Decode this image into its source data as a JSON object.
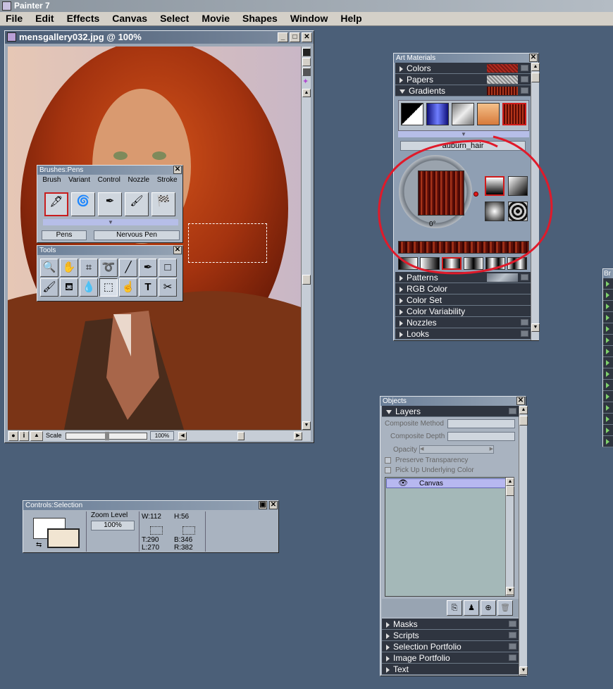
{
  "app": {
    "title": "Painter 7"
  },
  "menubar": [
    "File",
    "Edit",
    "Effects",
    "Canvas",
    "Select",
    "Movie",
    "Shapes",
    "Window",
    "Help"
  ],
  "document": {
    "title": "mensgallery032.jpg @ 100%",
    "scale_label": "Scale",
    "zoom": "100%"
  },
  "brushes": {
    "title": "Brushes:Pens",
    "tabs": [
      "Brush",
      "Variant",
      "Control",
      "Nozzle",
      "Stroke"
    ],
    "category": "Pens",
    "variant": "Nervous Pen"
  },
  "tools": {
    "title": "Tools"
  },
  "art_materials": {
    "title": "Art Materials",
    "sections_top": [
      "Colors",
      "Papers",
      "Gradients"
    ],
    "gradient_name": "auburn_hair",
    "angle": "0°",
    "sections_bottom": [
      "Patterns",
      "RGB Color",
      "Color Set",
      "Color Variability",
      "Nozzles",
      "Looks"
    ]
  },
  "controls": {
    "title": "Controls:Selection",
    "zoom_label": "Zoom Level",
    "zoom_value": "100%",
    "w": "W:112",
    "h": "H:56",
    "t": "T:290",
    "l": "L:270",
    "b": "B:346",
    "r": "R:382"
  },
  "objects": {
    "title": "Objects",
    "section": "Layers",
    "composite_method": "Composite Method",
    "composite_depth": "Composite Depth",
    "opacity": "Opacity",
    "preserve_transparency": "Preserve Transparency",
    "pick_up": "Pick Up Underlying Color",
    "layer_name": "Canvas",
    "sections_bottom": [
      "Masks",
      "Scripts",
      "Selection Portfolio",
      "Image Portfolio",
      "Text"
    ]
  },
  "partial_panel": {
    "label": "Br"
  }
}
